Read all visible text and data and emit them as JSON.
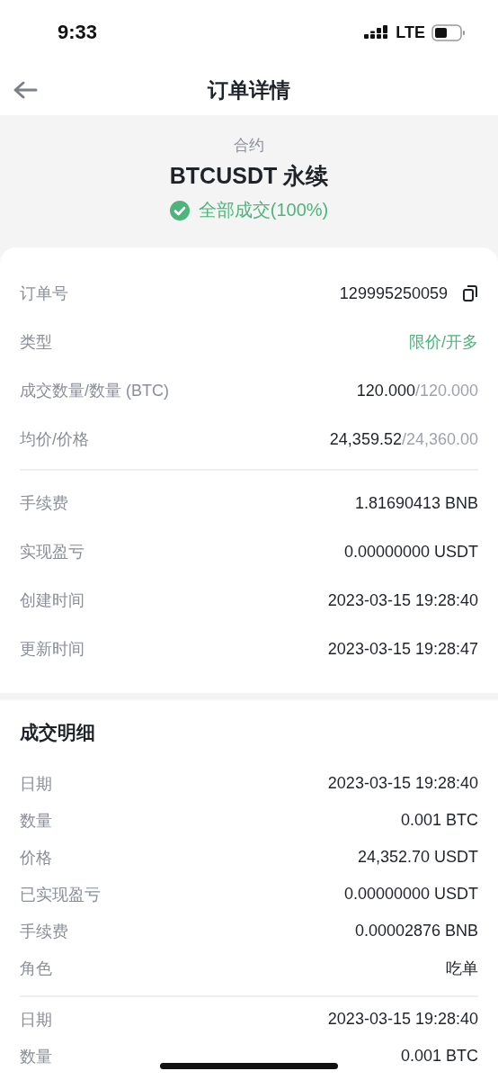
{
  "status_bar": {
    "time": "9:33",
    "network": "LTE"
  },
  "header": {
    "title": "订单详情"
  },
  "summary": {
    "category": "合约",
    "symbol": "BTCUSDT 永续",
    "status": "全部成交(100%)",
    "filled": true
  },
  "order_details": {
    "groups": [
      {
        "rows": [
          {
            "label": "订单号",
            "value": "129995250059",
            "copyable": true
          },
          {
            "label": "类型",
            "value": "限价/开多",
            "color": "#4fb37c"
          },
          {
            "label": "成交数量/数量 (BTC)",
            "value": "120.000",
            "secondary": "/120.000"
          },
          {
            "label": "均价/价格",
            "value": "24,359.52",
            "secondary": "/24,360.00"
          }
        ]
      },
      {
        "rows": [
          {
            "label": "手续费",
            "value": "1.81690413 BNB"
          },
          {
            "label": "实现盈亏",
            "value": "0.00000000 USDT"
          },
          {
            "label": "创建时间",
            "value": "2023-03-15 19:28:40"
          },
          {
            "label": "更新时间",
            "value": "2023-03-15 19:28:47"
          }
        ]
      }
    ]
  },
  "fills": {
    "title": "成交明细",
    "entries": [
      {
        "rows": [
          {
            "label": "日期",
            "value": "2023-03-15 19:28:40"
          },
          {
            "label": "数量",
            "value": "0.001 BTC"
          },
          {
            "label": "价格",
            "value": "24,352.70 USDT"
          },
          {
            "label": "已实现盈亏",
            "value": "0.00000000 USDT"
          },
          {
            "label": "手续费",
            "value": "0.00002876 BNB"
          },
          {
            "label": "角色",
            "value": "吃单"
          }
        ]
      },
      {
        "rows": [
          {
            "label": "日期",
            "value": "2023-03-15 19:28:40"
          },
          {
            "label": "数量",
            "value": "0.001 BTC"
          }
        ]
      }
    ]
  }
}
